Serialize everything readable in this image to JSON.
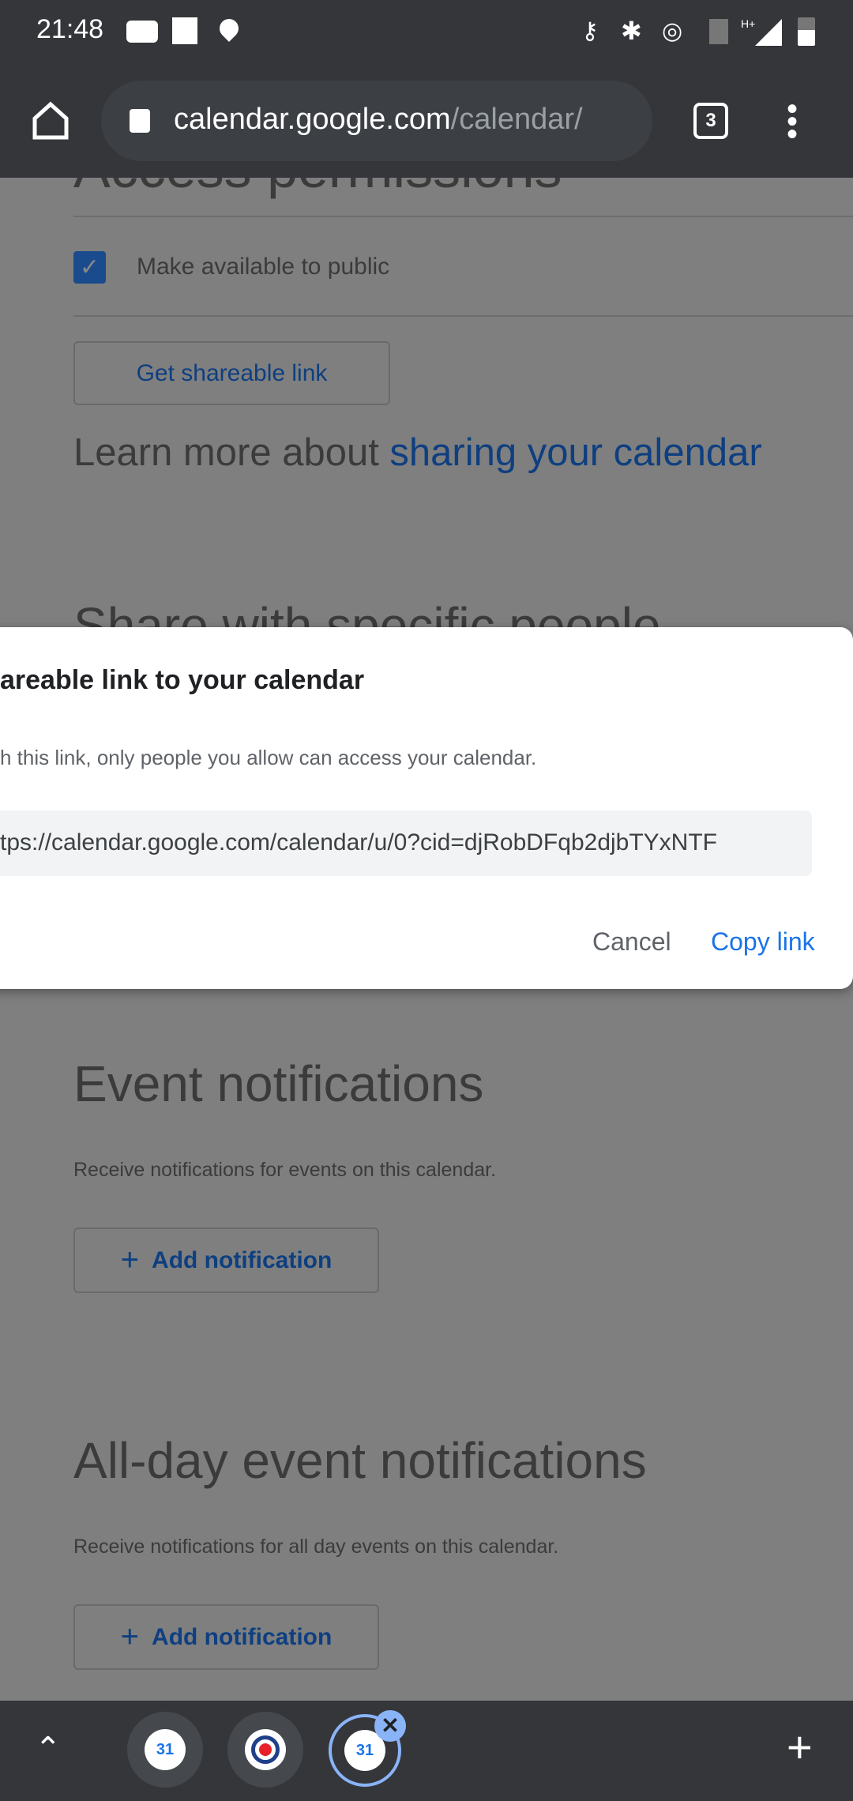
{
  "status_bar": {
    "time": "21:48",
    "icons": [
      "youtube-icon",
      "square-notification-icon",
      "location-icon",
      "vpn-key-icon",
      "bluetooth-icon",
      "hotspot-icon",
      "no-sim-icon",
      "signal-hplus-icon",
      "battery-icon"
    ],
    "network": "H+"
  },
  "browser": {
    "url_domain": "calendar.google.com",
    "url_path": "/calendar/",
    "tab_count": "3"
  },
  "page": {
    "access_heading": "Access permissions",
    "public_checkbox_label": "Make available to public",
    "public_checked": true,
    "get_link_button": "Get shareable link",
    "learn_more_prefix": "Learn more about ",
    "learn_more_link": "sharing your calendar",
    "share_heading": "Share with specific people",
    "event_heading": "Event notifications",
    "event_desc": "Receive notifications for events on this calendar.",
    "add_notification": "Add notification",
    "allday_heading": "All-day event notifications",
    "allday_desc": "Receive notifications for all day events on this calendar."
  },
  "dialog": {
    "title": "areable link to your calendar",
    "description": "h this link, only people you allow can access your calendar.",
    "link_value": "tps://calendar.google.com/calendar/u/0?cid=djRobDFqb2djbTYxNTF",
    "cancel": "Cancel",
    "copy": "Copy link",
    "accent": "#1a73e8"
  },
  "bottom_bar": {
    "tabs": [
      {
        "icon": "calendar-app-icon",
        "label": "31"
      },
      {
        "icon": "record-icon"
      },
      {
        "icon": "google-calendar-icon",
        "label": "31",
        "active": true
      }
    ]
  }
}
